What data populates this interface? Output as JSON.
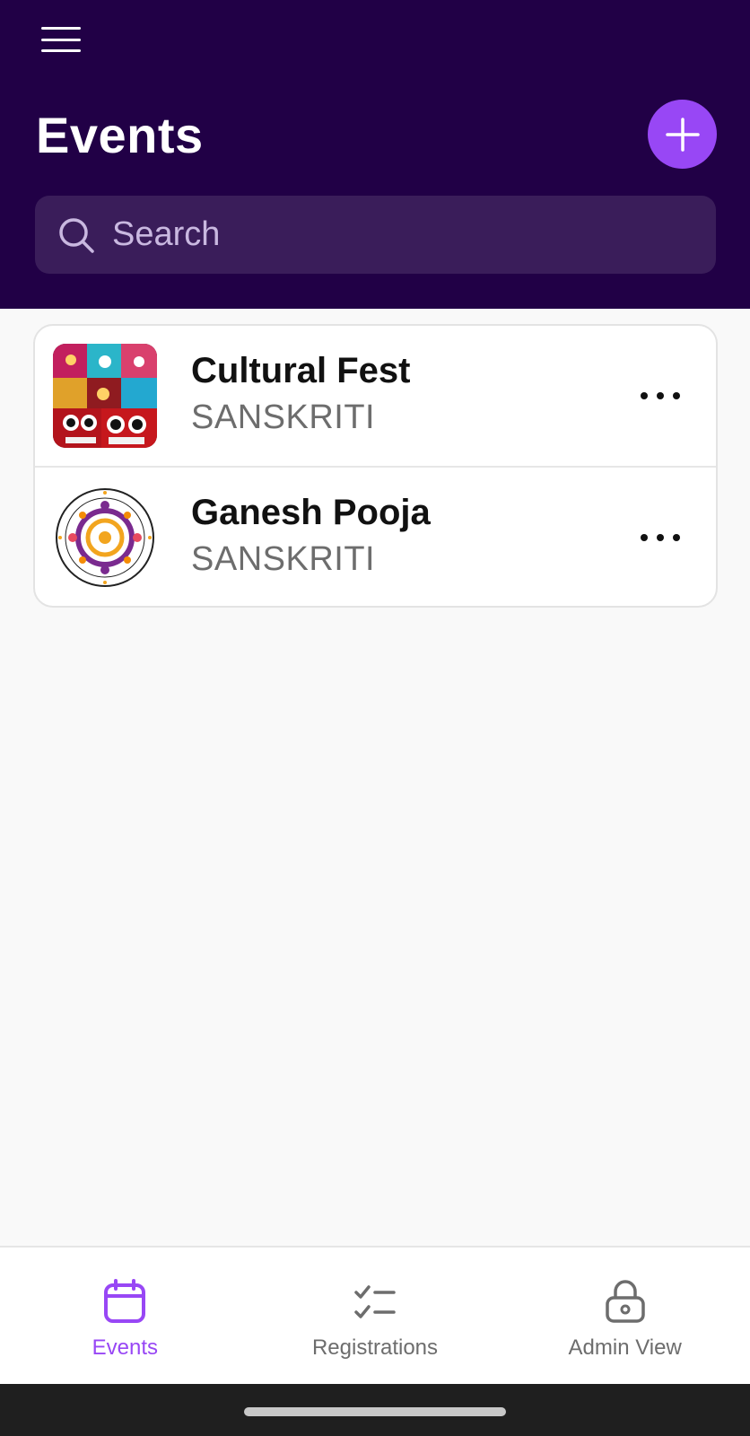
{
  "header": {
    "title": "Events",
    "search_placeholder": "Search",
    "background": "#210046",
    "accent": "#9847f5"
  },
  "events": [
    {
      "title": "Cultural Fest",
      "organizer": "SANSKRITI",
      "thumbnail": "colorful-skulls-image"
    },
    {
      "title": "Ganesh Pooja",
      "organizer": "SANSKRITI",
      "thumbnail": "club-logo-image"
    }
  ],
  "bottom_nav": {
    "items": [
      {
        "label": "Events",
        "icon": "calendar-icon",
        "active": true
      },
      {
        "label": "Registrations",
        "icon": "checklist-icon",
        "active": false
      },
      {
        "label": "Admin View",
        "icon": "lock-icon",
        "active": false
      }
    ]
  }
}
